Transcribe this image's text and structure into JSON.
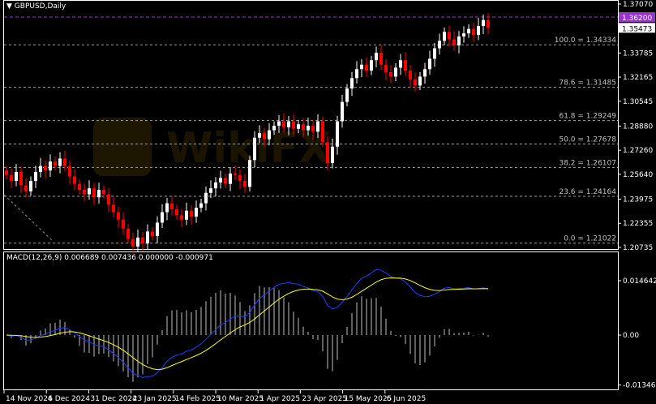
{
  "chart_data": [
    {
      "type": "candlestick",
      "title": "GBPUSD,Daily",
      "symbol": "GBPUSD",
      "timeframe": "Daily",
      "ylim": [
        1.20735,
        1.3707
      ],
      "y_ticks": [
        "1.37070",
        "1.33785",
        "1.32165",
        "1.30545",
        "1.28880",
        "1.27260",
        "1.25640",
        "1.23975",
        "1.22355",
        "1.20735"
      ],
      "x_ticks": [
        "14 Nov 2024",
        "6 Dec 2024",
        "31 Dec 2024",
        "23 Jan 2025",
        "14 Feb 2025",
        "10 Mar 2025",
        "1 Apr 2025",
        "23 Apr 2025",
        "15 May 2025",
        "6 Jun 2025"
      ],
      "bid_label": "1.35473",
      "ask_line_label": "1.36200",
      "ask_line_value": 1.362,
      "bid_value": 1.35473,
      "fibonacci": [
        {
          "label": "100.0 = 1.34334",
          "value": 1.34334
        },
        {
          "label": "78.6 = 1.31485",
          "value": 1.31485
        },
        {
          "label": "61.8 = 1.29249",
          "value": 1.29249
        },
        {
          "label": "50.0 = 1.27678",
          "value": 1.27678
        },
        {
          "label": "38.2 = 1.26107",
          "value": 1.26107
        },
        {
          "label": "23.6 = 1.24164",
          "value": 1.24164
        },
        {
          "label": "0.0 = 1.21022",
          "value": 1.21022
        }
      ],
      "closes": [
        1.256,
        1.252,
        1.258,
        1.249,
        1.245,
        1.252,
        1.258,
        1.262,
        1.259,
        1.265,
        1.262,
        1.267,
        1.262,
        1.255,
        1.25,
        1.246,
        1.243,
        1.247,
        1.241,
        1.246,
        1.243,
        1.236,
        1.231,
        1.226,
        1.22,
        1.213,
        1.208,
        1.214,
        1.21,
        1.218,
        1.215,
        1.224,
        1.231,
        1.237,
        1.233,
        1.229,
        1.226,
        1.232,
        1.228,
        1.234,
        1.237,
        1.244,
        1.247,
        1.251,
        1.254,
        1.25,
        1.257,
        1.256,
        1.252,
        1.248,
        1.266,
        1.281,
        1.284,
        1.28,
        1.286,
        1.289,
        1.292,
        1.288,
        1.292,
        1.287,
        1.29,
        1.286,
        1.289,
        1.285,
        1.292,
        1.278,
        1.264,
        1.275,
        1.292,
        1.305,
        1.314,
        1.321,
        1.327,
        1.33,
        1.326,
        1.333,
        1.338,
        1.33,
        1.325,
        1.322,
        1.328,
        1.333,
        1.326,
        1.32,
        1.316,
        1.322,
        1.327,
        1.334,
        1.341,
        1.346,
        1.352,
        1.347,
        1.343,
        1.349,
        1.351,
        1.354,
        1.35,
        1.356,
        1.36,
        1.35473
      ],
      "colors": {
        "bull": "#ffffff",
        "bear": "#ff0000",
        "ask": "#9933cc",
        "fib": "#a0a0a0"
      }
    },
    {
      "type": "line",
      "title": "MACD(12,26,9) 0.006689 0.007436 0.000000 -0.000971",
      "y_ticks": [
        "0.014642",
        "0.00",
        "-0.013461"
      ],
      "ylim": [
        -0.015,
        0.017
      ],
      "colors": {
        "macd": "#1e3cff",
        "signal": "#ffff00",
        "histogram": "#c0c0c0"
      }
    }
  ]
}
